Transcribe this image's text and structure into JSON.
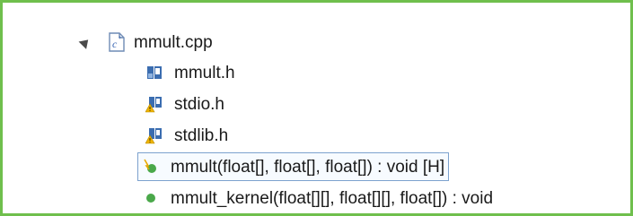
{
  "tree": {
    "root": {
      "label": "mmult.cpp",
      "icon": "cpp-file-icon",
      "expanded": true
    },
    "children": [
      {
        "label": "mmult.h",
        "icon": "header-file-icon",
        "warning": false
      },
      {
        "label": "stdio.h",
        "icon": "header-file-warning-icon",
        "warning": true
      },
      {
        "label": "stdlib.h",
        "icon": "header-file-warning-icon",
        "warning": true
      },
      {
        "label": "mmult(float[], float[], float[]) : void [H]",
        "icon": "function-hw-icon",
        "selected": true
      },
      {
        "label": "mmult_kernel(float[][], float[][], float[]) : void",
        "icon": "function-icon",
        "selected": false
      }
    ]
  },
  "colors": {
    "frame_border": "#6fbf4d",
    "selection_border": "#7da2ce",
    "function_dot": "#4aa84a",
    "header_icon": "#3b6db0",
    "warning": "#f0b400"
  }
}
